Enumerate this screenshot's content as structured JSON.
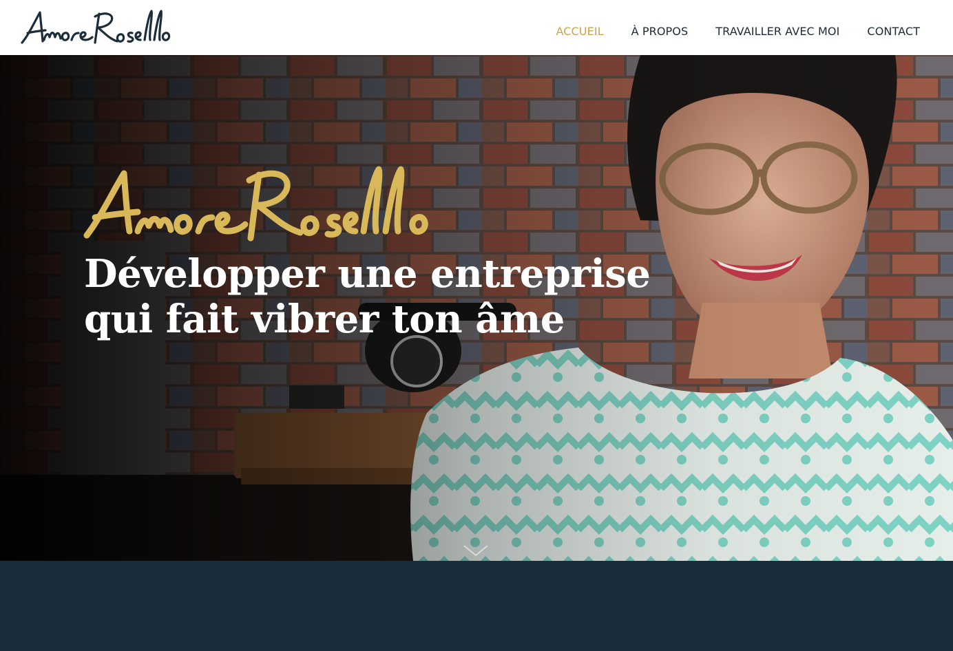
{
  "header": {
    "logo_text": "AmoreRosello",
    "nav": [
      {
        "label": "ACCUEIL",
        "active": true
      },
      {
        "label": "À PROPOS",
        "active": false
      },
      {
        "label": "TRAVAILLER AVEC MOI",
        "active": false
      },
      {
        "label": "CONTACT",
        "active": false
      }
    ]
  },
  "hero": {
    "signature_text": "AmoreRosello",
    "tagline_line1": "Développer une entreprise",
    "tagline_line2": "qui fait vibrer ton âme",
    "scroll_icon": "chevron-down-icon"
  },
  "colors": {
    "accent": "#c9a44a",
    "nav_text": "#1d2a36",
    "band": "#1b2d3a",
    "tagline": "#ffffff"
  }
}
